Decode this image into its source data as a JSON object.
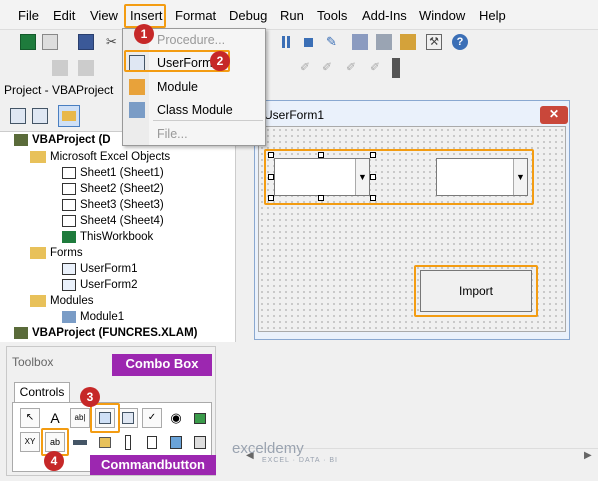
{
  "menubar": {
    "items": [
      "File",
      "Edit",
      "View",
      "Insert",
      "Format",
      "Debug",
      "Run",
      "Tools",
      "Add-Ins",
      "Window",
      "Help"
    ]
  },
  "insert_menu": {
    "items": [
      "Procedure...",
      "UserForm",
      "Module",
      "Class Module",
      "File..."
    ]
  },
  "project": {
    "title": "Project - VBAProject",
    "tree": [
      "VBAProject (D",
      "Microsoft Excel Objects",
      "Sheet1 (Sheet1)",
      "Sheet2 (Sheet2)",
      "Sheet3 (Sheet3)",
      "Sheet4 (Sheet4)",
      "ThisWorkbook",
      "Forms",
      "UserForm1",
      "UserForm2",
      "Modules",
      "Module1",
      "VBAProject (FUNCRES.XLAM)"
    ]
  },
  "toolbox": {
    "title": "Toolbox",
    "tab": "Controls",
    "icons_row1": [
      "A",
      "ab|",
      "",
      "",
      "✓",
      "◉",
      ""
    ],
    "icons_row2": [
      "XY",
      "ab",
      "",
      "",
      "",
      "",
      ""
    ]
  },
  "form": {
    "title": "UserForm1",
    "close_glyph": "✕",
    "import_label": "Import"
  },
  "callouts": {
    "combo_box": "Combo Box",
    "commandbutton": "Commandbutton"
  },
  "badges": [
    "1",
    "2",
    "3",
    "4"
  ],
  "watermark": {
    "brand": "exceldemy",
    "tagline": "EXCEL · DATA · BI"
  },
  "colors": {
    "highlight": "#f39c12",
    "badge": "#c62828",
    "callout": "#9c27b0"
  }
}
